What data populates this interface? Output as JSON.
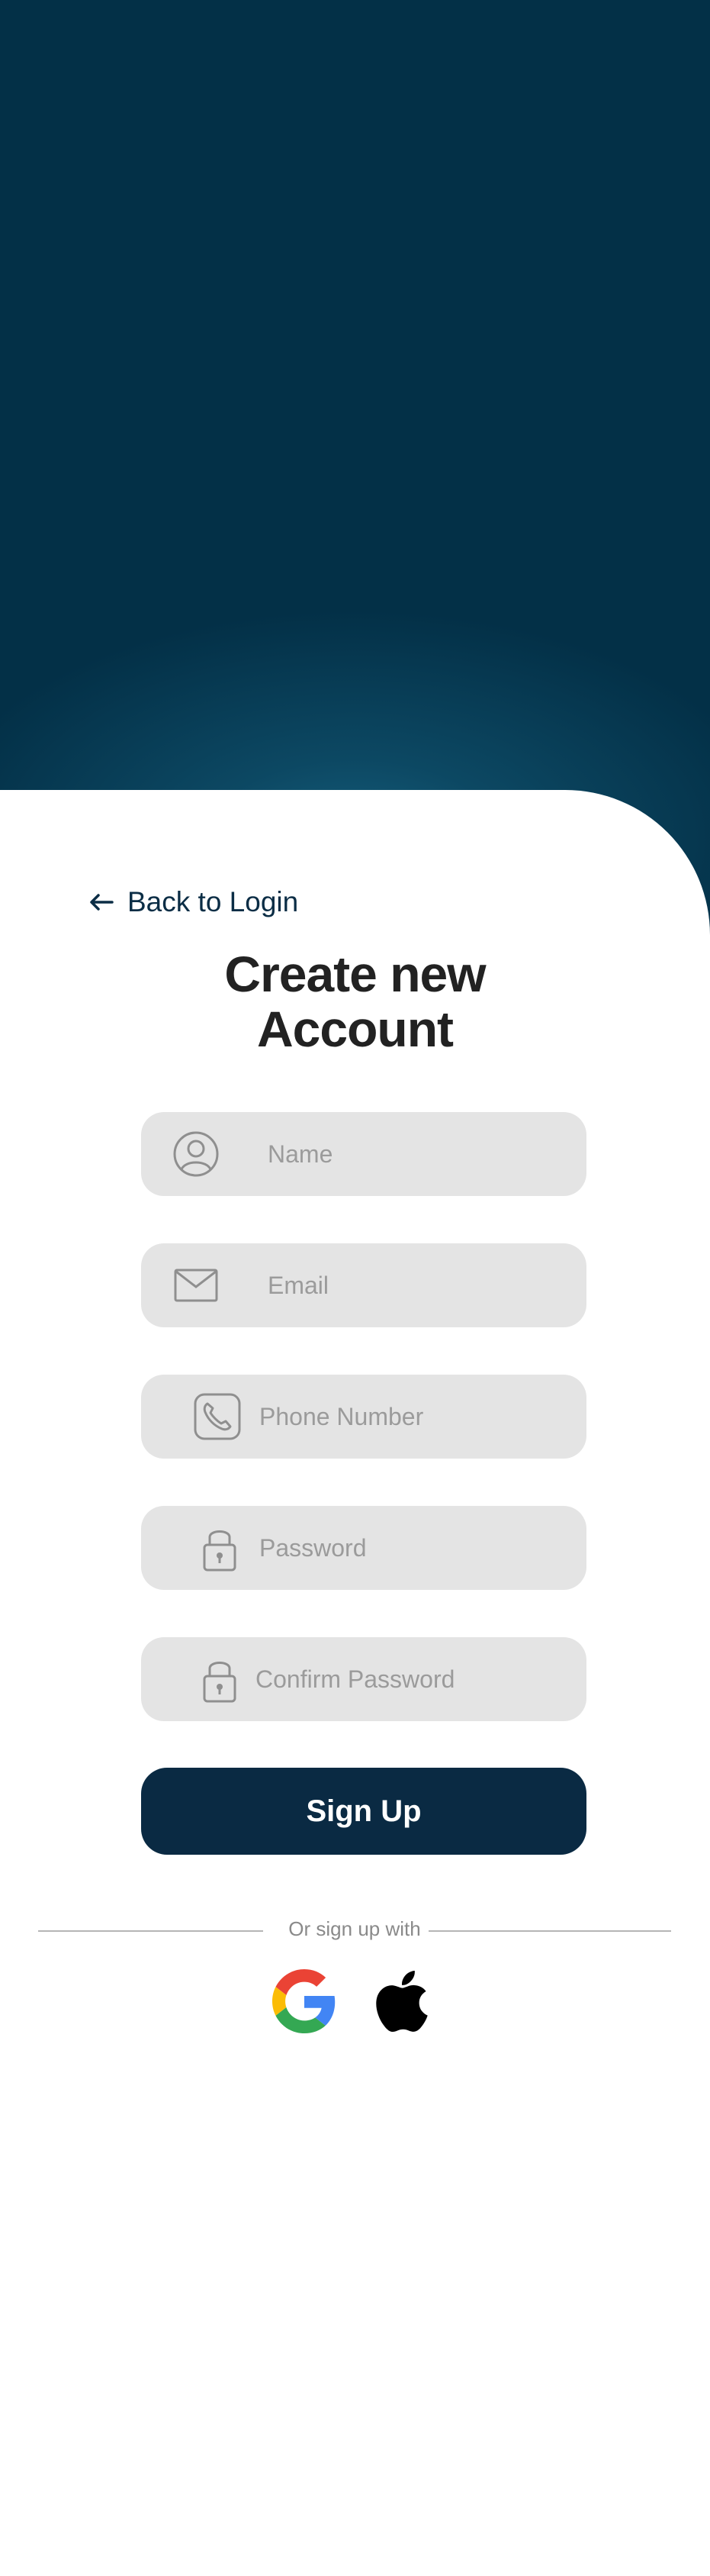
{
  "nav": {
    "back_label": "Back to Login"
  },
  "header": {
    "title_line1": "Create new",
    "title_line2": "Account"
  },
  "form": {
    "name_placeholder": "Name",
    "email_placeholder": "Email",
    "phone_placeholder": "Phone Number",
    "password_placeholder": "Password",
    "confirm_password_placeholder": "Confirm Password",
    "submit_label": "Sign Up"
  },
  "social": {
    "divider_text": "Or sign up with",
    "providers": [
      {
        "name": "google",
        "icon": "google-icon"
      },
      {
        "name": "apple",
        "icon": "apple-icon"
      }
    ]
  },
  "colors": {
    "hero_bg": "#033047",
    "primary_button": "#0a2a43",
    "input_bg": "#e4e4e4",
    "title_text": "#222222"
  }
}
